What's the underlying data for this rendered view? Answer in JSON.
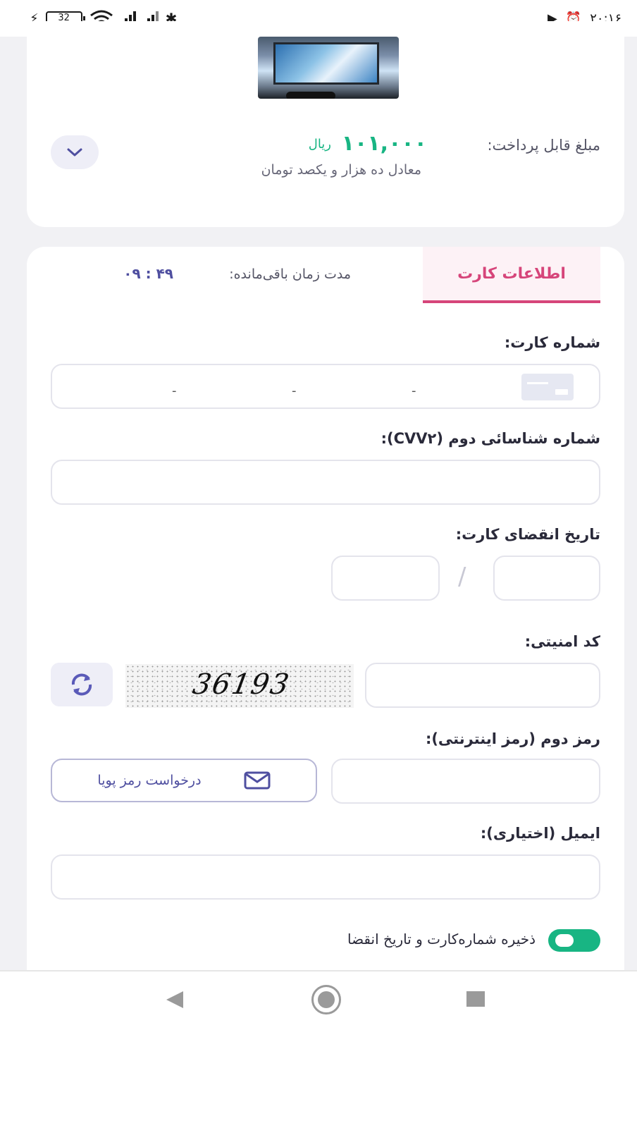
{
  "status_bar": {
    "battery": "32",
    "time": "۲۰:۱۶"
  },
  "summary": {
    "pay_label": "مبلغ قابل پرداخت:",
    "amount": "۱۰۱,۰۰۰",
    "unit": "ریال",
    "equivalent": "معادل ده هزار و یکصد تومان"
  },
  "tabs": {
    "card_info": "اطلاعات کارت",
    "timer_label": "مدت زمان باقی‌مانده:",
    "timer_value": "۰۹ : ۴۹"
  },
  "form": {
    "card_number_label": "شماره کارت:",
    "card_separator": "-",
    "cvv2_label": "شماره شناسائی دوم (CVV۲):",
    "expiry_label": "تاریخ انقضای کارت:",
    "expiry_separator": "/",
    "security_code_label": "کد امنیتی:",
    "captcha_text": "36193",
    "password_label": "رمز دوم (رمز اینترنتی):",
    "otp_button": "درخواست رمز پویا",
    "email_label": "ایمیل (اختیاری):",
    "save_card_label": "ذخیره شماره‌کارت و تاریخ انقضا"
  },
  "colors": {
    "accent_pink": "#d6457a",
    "accent_green": "#18b583",
    "accent_purple": "#4f4fa0"
  },
  "icons": [
    "lightning-icon",
    "battery-icon",
    "wifi-icon",
    "signal-icon",
    "bluetooth-icon",
    "play-icon",
    "alarm-icon",
    "chevron-down-icon",
    "credit-card-icon",
    "refresh-icon",
    "envelope-icon",
    "back-icon",
    "home-icon",
    "recents-icon"
  ]
}
